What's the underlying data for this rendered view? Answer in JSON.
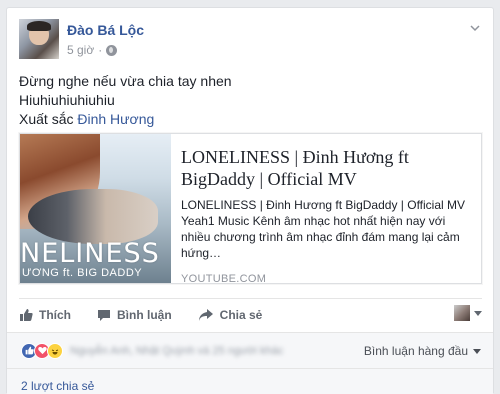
{
  "post": {
    "author": "Đào Bá Lộc",
    "time": "5 giờ",
    "separator": "·",
    "privacy_icon": "globe-icon",
    "lines": [
      "Đừng nghe nếu vừa chia tay nhen",
      "Hiuhiuhiuhiuhiu"
    ],
    "mention_prefix": "Xuất sắc ",
    "mention": "Đinh Hương"
  },
  "preview": {
    "title": "LONELINESS | Đinh Hương ft BigDaddy | Official MV",
    "description": "LONELINESS | Đinh Hương ft BigDaddy | Official MV Yeah1 Music Kênh âm nhạc hot nhất hiện nay với nhiều chương trình âm nhạc đỉnh đám mang lại cảm hứng…",
    "domain": "YOUTUBE.COM",
    "thumb_title": "NELINESS",
    "thumb_subtitle": "ƯƠNG ft. BIG DADDY"
  },
  "actions": {
    "like": "Thích",
    "comment": "Bình luận",
    "share": "Chia sẻ"
  },
  "reactions": {
    "types": [
      "like",
      "love",
      "haha"
    ],
    "names_blurred": "Nguyễn Anh, Nhật Quỳnh và 25 người khác",
    "sort_label": "Bình luận hàng đầu"
  },
  "shares": "2 lượt chia sẻ",
  "colors": {
    "link": "#365899",
    "meta": "#90949c",
    "like": "#4267b2",
    "love": "#f25268",
    "haha": "#fcd240"
  }
}
